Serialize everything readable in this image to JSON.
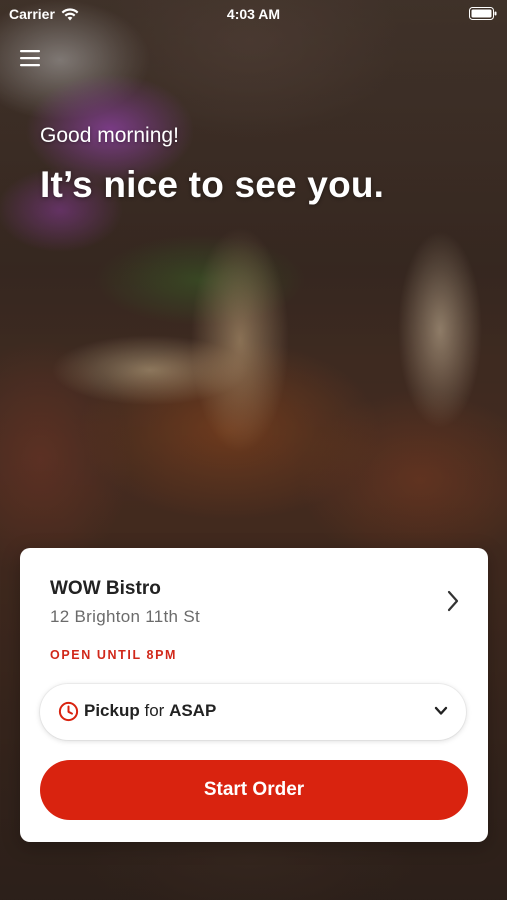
{
  "status_bar": {
    "carrier": "Carrier",
    "time": "4:03 AM"
  },
  "header": {
    "greeting": "Good morning!",
    "headline": "It’s nice to see you."
  },
  "store": {
    "name": "WOW Bistro",
    "address": "12 Brighton 11th St",
    "hours": "OPEN UNTIL 8PM"
  },
  "order_mode": {
    "mode": "Pickup",
    "connector": "for",
    "time": "ASAP"
  },
  "actions": {
    "start_order": "Start Order"
  },
  "colors": {
    "accent": "#d9230f",
    "hours_text": "#d1281a",
    "card_bg": "#ffffff"
  },
  "icons": {
    "menu": "hamburger-menu-icon",
    "wifi": "wifi-icon",
    "battery": "battery-icon",
    "store_chevron": "chevron-right-icon",
    "clock": "clock-icon",
    "dropdown": "chevron-down-icon"
  }
}
